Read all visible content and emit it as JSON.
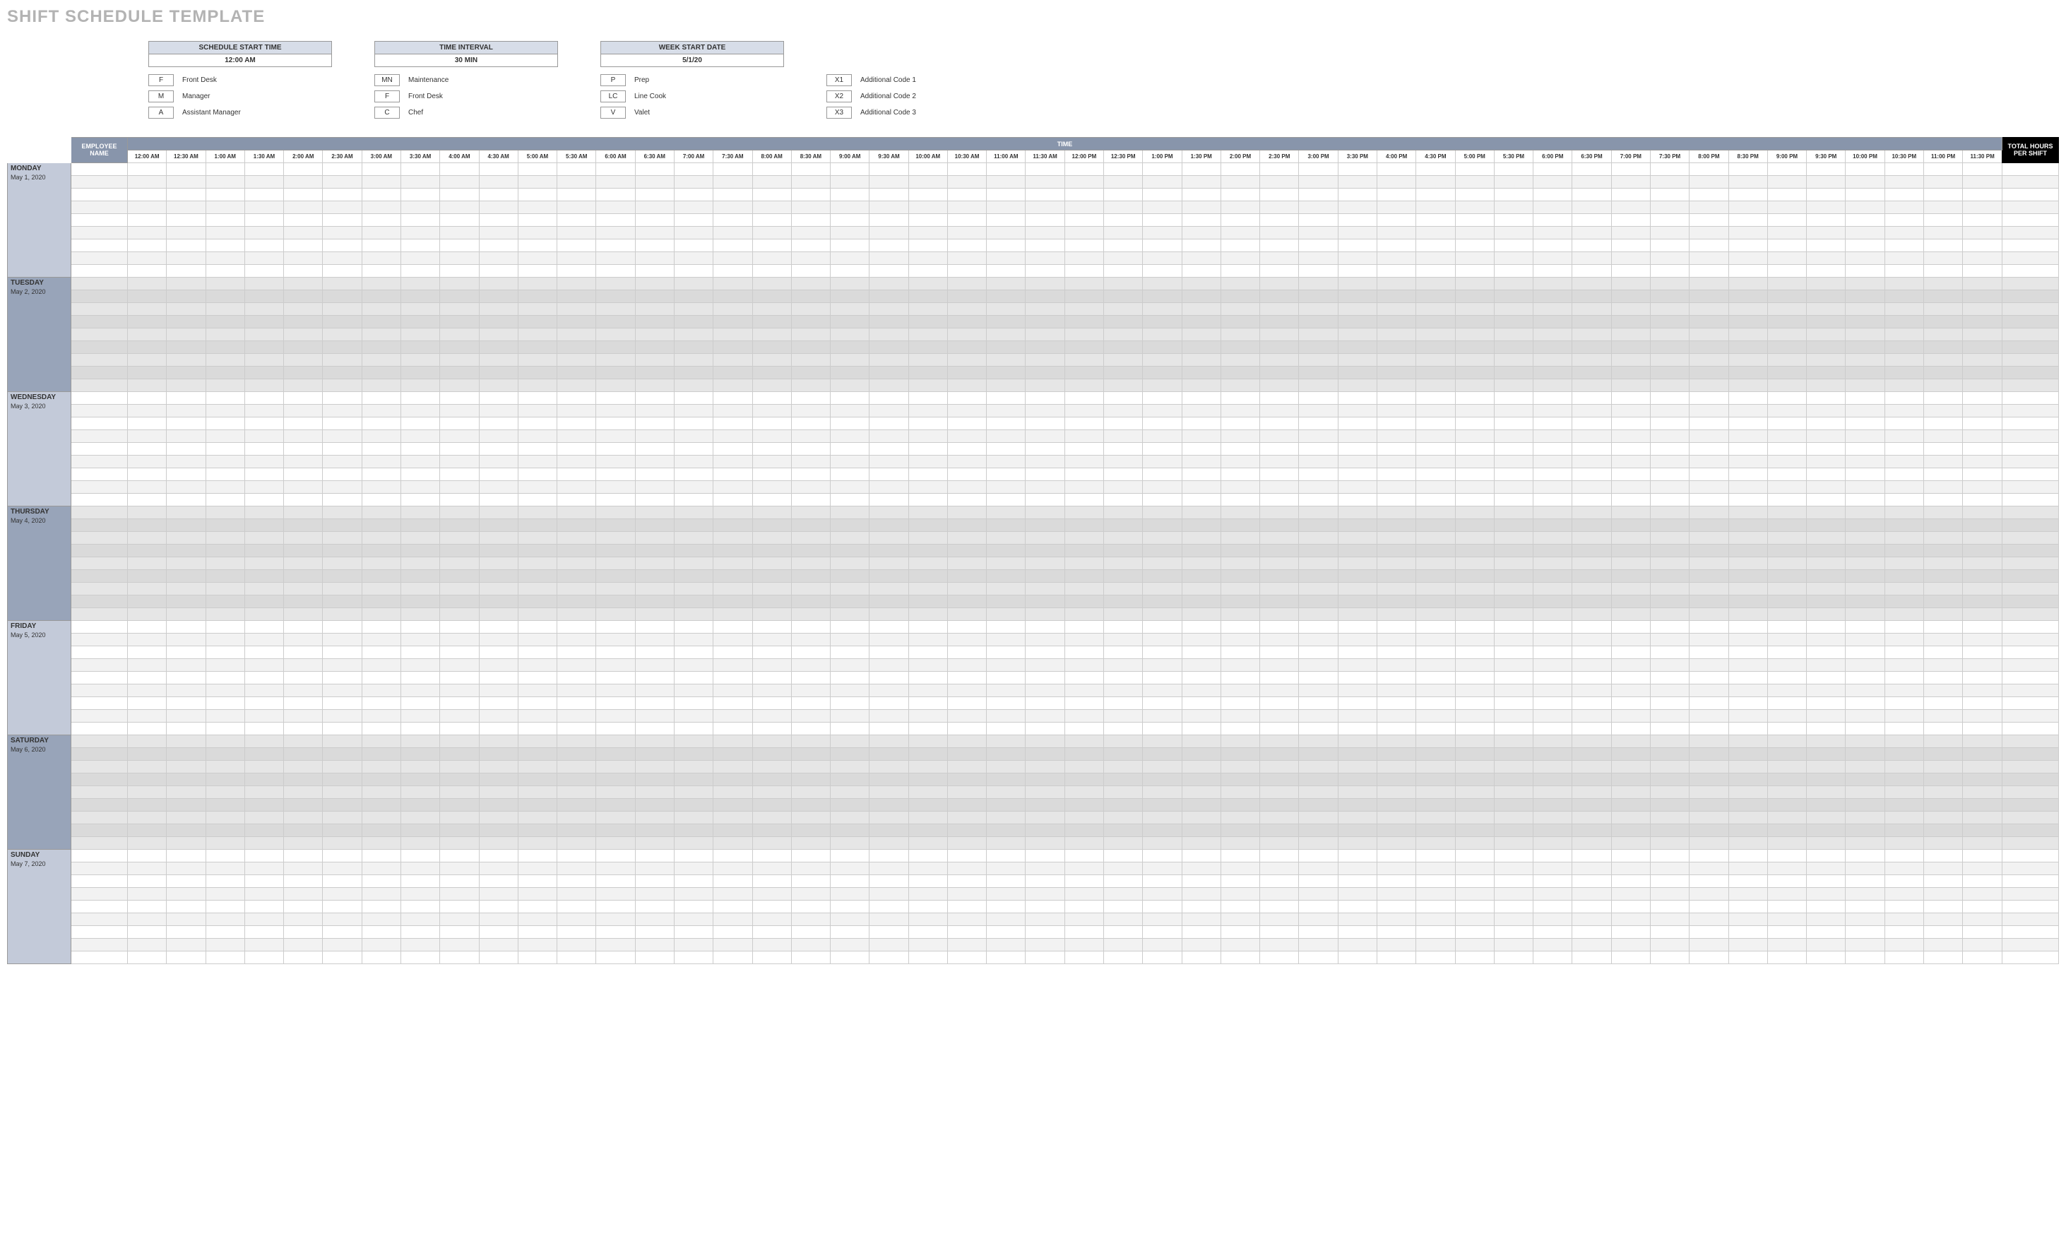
{
  "title": "SHIFT SCHEDULE TEMPLATE",
  "config": {
    "start_time": {
      "label": "SCHEDULE START TIME",
      "value": "12:00 AM"
    },
    "interval": {
      "label": "TIME INTERVAL",
      "value": "30 MIN"
    },
    "week_start": {
      "label": "WEEK START DATE",
      "value": "5/1/20"
    }
  },
  "legend": [
    [
      {
        "code": "F",
        "label": "Front Desk"
      },
      {
        "code": "M",
        "label": "Manager"
      },
      {
        "code": "A",
        "label": "Assistant Manager"
      }
    ],
    [
      {
        "code": "MN",
        "label": "Maintenance"
      },
      {
        "code": "F",
        "label": "Front Desk"
      },
      {
        "code": "C",
        "label": "Chef"
      }
    ],
    [
      {
        "code": "P",
        "label": "Prep"
      },
      {
        "code": "LC",
        "label": "Line Cook"
      },
      {
        "code": "V",
        "label": "Valet"
      }
    ],
    [
      {
        "code": "X1",
        "label": "Additional Code 1"
      },
      {
        "code": "X2",
        "label": "Additional Code 2"
      },
      {
        "code": "X3",
        "label": "Additional Code 3"
      }
    ]
  ],
  "headers": {
    "employee": "EMPLOYEE NAME",
    "time": "TIME",
    "total": "TOTAL HOURS PER SHIFT"
  },
  "time_slots": [
    "12:00 AM",
    "12:30 AM",
    "1:00 AM",
    "1:30 AM",
    "2:00 AM",
    "2:30 AM",
    "3:00 AM",
    "3:30 AM",
    "4:00 AM",
    "4:30 AM",
    "5:00 AM",
    "5:30 AM",
    "6:00 AM",
    "6:30 AM",
    "7:00 AM",
    "7:30 AM",
    "8:00 AM",
    "8:30 AM",
    "9:00 AM",
    "9:30 AM",
    "10:00 AM",
    "10:30 AM",
    "11:00 AM",
    "11:30 AM",
    "12:00 PM",
    "12:30 PM",
    "1:00 PM",
    "1:30 PM",
    "2:00 PM",
    "2:30 PM",
    "3:00 PM",
    "3:30 PM",
    "4:00 PM",
    "4:30 PM",
    "5:00 PM",
    "5:30 PM",
    "6:00 PM",
    "6:30 PM",
    "7:00 PM",
    "7:30 PM",
    "8:00 PM",
    "8:30 PM",
    "9:00 PM",
    "9:30 PM",
    "10:00 PM",
    "10:30 PM",
    "11:00 PM",
    "11:30 PM"
  ],
  "days": [
    {
      "name": "MONDAY",
      "date": "May 1, 2020",
      "alt": false
    },
    {
      "name": "TUESDAY",
      "date": "May 2, 2020",
      "alt": true
    },
    {
      "name": "WEDNESDAY",
      "date": "May 3, 2020",
      "alt": false
    },
    {
      "name": "THURSDAY",
      "date": "May 4, 2020",
      "alt": true
    },
    {
      "name": "FRIDAY",
      "date": "May 5, 2020",
      "alt": false
    },
    {
      "name": "SATURDAY",
      "date": "May 6, 2020",
      "alt": true
    },
    {
      "name": "SUNDAY",
      "date": "May 7, 2020",
      "alt": false
    }
  ],
  "rows_per_day": 9
}
